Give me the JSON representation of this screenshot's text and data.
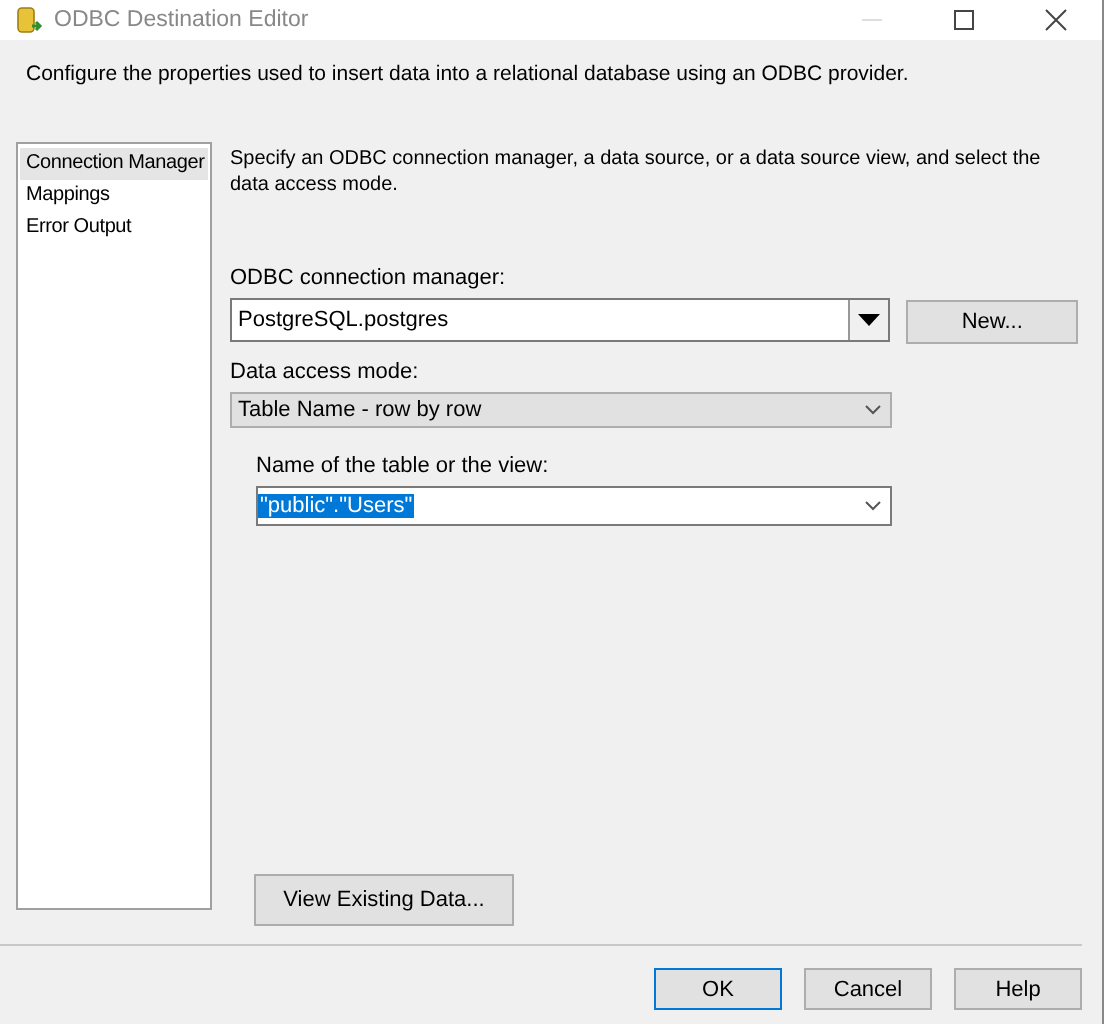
{
  "window": {
    "title": "ODBC Destination Editor"
  },
  "description": "Configure the properties used to insert data into a relational database using an ODBC provider.",
  "sidebar": {
    "items": [
      {
        "label": "Connection Manager",
        "selected": true
      },
      {
        "label": "Mappings",
        "selected": false
      },
      {
        "label": "Error Output",
        "selected": false
      }
    ]
  },
  "instructions": "Specify an ODBC connection manager, a data source, or a data source view, and select the data access mode.",
  "connection_manager": {
    "label": "ODBC connection manager:",
    "value": "PostgreSQL.postgres",
    "kind": "editable",
    "button": "New..."
  },
  "data_access_mode": {
    "label": "Data access mode:",
    "value": "Table Name - row by row",
    "kind": "flat"
  },
  "table": {
    "label": "Name of the table or the view:",
    "value": "\"public\".\"Users\"",
    "kind": "white",
    "selected": true
  },
  "view_button": "View Existing Data...",
  "buttons": [
    {
      "label": "OK",
      "default": true
    },
    {
      "label": "Cancel",
      "default": false
    },
    {
      "label": "Help",
      "default": false
    }
  ]
}
